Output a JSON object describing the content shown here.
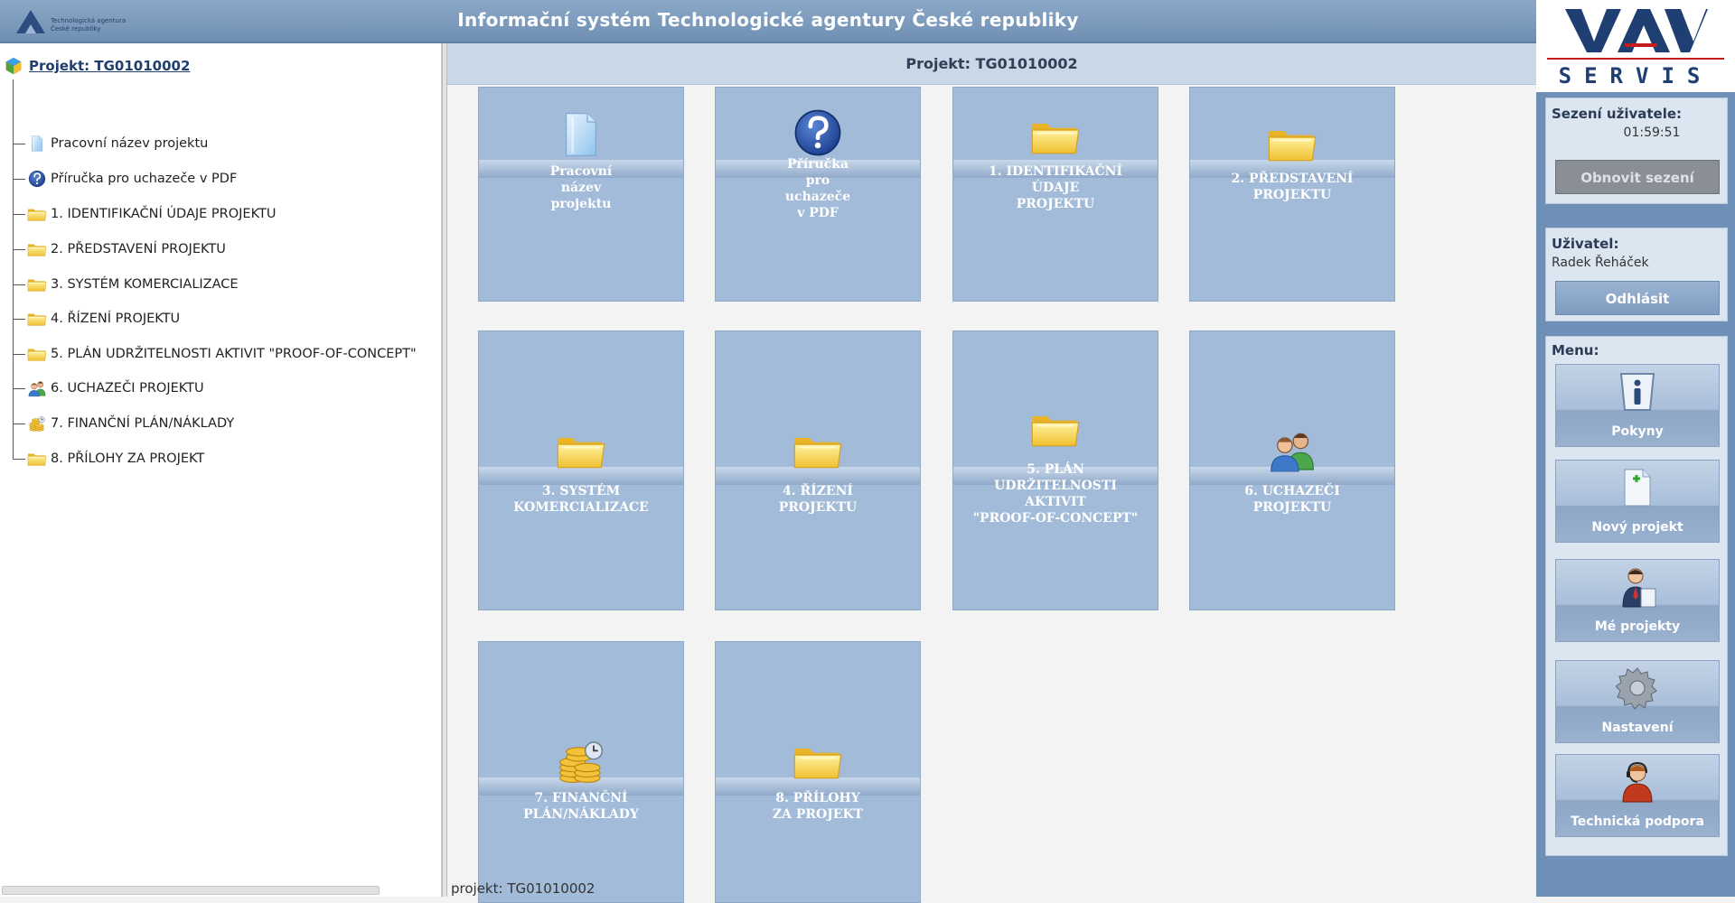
{
  "header": {
    "logo_text_1": "Technologická agentura",
    "logo_text_2": "České republiky",
    "title": "Informační systém Technologické agentury České republiky"
  },
  "tree": {
    "root_label": "Projekt: TG01010002",
    "items": [
      {
        "label": "Pracovní název projektu",
        "icon": "document-icon"
      },
      {
        "label": "Příručka pro uchazeče v PDF",
        "icon": "help-icon"
      },
      {
        "label": "1. IDENTIFIKAČNÍ ÚDAJE PROJEKTU",
        "icon": "folder-icon"
      },
      {
        "label": "2. PŘEDSTAVENÍ PROJEKTU",
        "icon": "folder-icon"
      },
      {
        "label": "3. SYSTÉM KOMERCIALIZACE",
        "icon": "folder-icon"
      },
      {
        "label": "4. ŘÍZENÍ PROJEKTU",
        "icon": "folder-icon"
      },
      {
        "label": "5. PLÁN UDRŽITELNOSTI AKTIVIT \"PROOF-OF-CONCEPT\"",
        "icon": "folder-icon"
      },
      {
        "label": "6. UCHAZEČI PROJEKTU",
        "icon": "users-icon"
      },
      {
        "label": "7. FINANČNÍ PLÁN/NÁKLADY",
        "icon": "coins-icon"
      },
      {
        "label": "8. PŘÍLOHY ZA PROJEKT",
        "icon": "folder-icon"
      }
    ]
  },
  "main": {
    "header": "Projekt: TG01010002",
    "status": "projekt: TG01010002",
    "tiles": [
      {
        "label": "Pracovní\nnázev\nprojektu",
        "icon": "document-icon"
      },
      {
        "label": "Příručka\npro\nuchazeče\nv PDF",
        "icon": "help-icon"
      },
      {
        "label": "1. IDENTIFIKAČNÍ\nÚDAJE\nPROJEKTU",
        "icon": "folder-icon"
      },
      {
        "label": "2. PŘEDSTAVENÍ\nPROJEKTU",
        "icon": "folder-icon"
      },
      {
        "label": "3. SYSTÉM\nKOMERCIALIZACE",
        "icon": "folder-icon"
      },
      {
        "label": "4. ŘÍZENÍ\nPROJEKTU",
        "icon": "folder-icon"
      },
      {
        "label": "5. PLÁN\nUDRŽITELNOSTI\nAKTIVIT\n\"PROOF-OF-CONCEPT\"",
        "icon": "folder-icon"
      },
      {
        "label": "6. UCHAZEČI\nPROJEKTU",
        "icon": "users-icon"
      },
      {
        "label": "7. FINANČNÍ\nPLÁN/NÁKLADY",
        "icon": "coins-icon"
      },
      {
        "label": "8. PŘÍLOHY\nZA PROJEKT",
        "icon": "folder-icon"
      }
    ]
  },
  "sidebar": {
    "logo_text": "SERVIS",
    "session_title": "Sezení uživatele:",
    "session_time": "01:59:51",
    "refresh_button": "Obnovit sezení",
    "user_title": "Uživatel:",
    "user_name": "Radek Řeháček",
    "logout_button": "Odhlásit",
    "menu_title": "Menu:",
    "menu_items": [
      {
        "label": "Pokyny",
        "icon": "info-icon"
      },
      {
        "label": "Nový projekt",
        "icon": "new-document-icon"
      },
      {
        "label": "Mé projekty",
        "icon": "person-icon"
      },
      {
        "label": "Nastavení",
        "icon": "gear-icon"
      },
      {
        "label": "Technická podpora",
        "icon": "support-icon"
      }
    ]
  },
  "colors": {
    "tile": "#a2bbd8",
    "header": "#7b99bc",
    "sidebar": "#6f90b6",
    "accent_red": "#c21c1c",
    "navy": "#1f3f73"
  }
}
